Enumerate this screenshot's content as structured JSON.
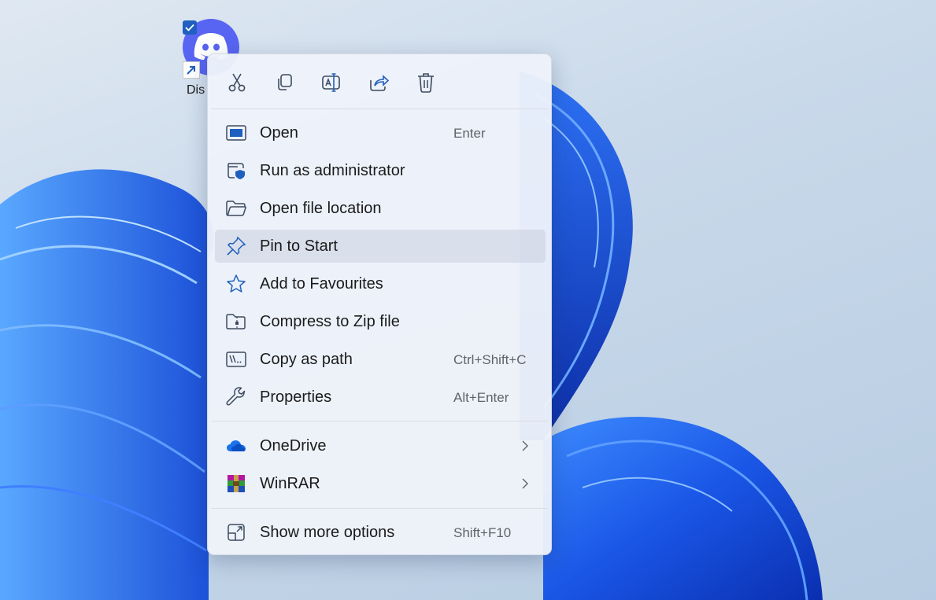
{
  "desktop": {
    "shortcut": {
      "label": "Dis",
      "icon": "discord-icon",
      "selected": true
    }
  },
  "context_menu": {
    "quick_actions": [
      {
        "name": "Cut",
        "icon": "scissors-icon"
      },
      {
        "name": "Copy",
        "icon": "copy-icon"
      },
      {
        "name": "Rename",
        "icon": "rename-icon"
      },
      {
        "name": "Share",
        "icon": "share-icon"
      },
      {
        "name": "Delete",
        "icon": "trash-icon"
      }
    ],
    "items": [
      {
        "label": "Open",
        "shortcut": "Enter",
        "icon": "open-window-icon"
      },
      {
        "label": "Run as administrator",
        "shortcut": "",
        "icon": "admin-shield-icon"
      },
      {
        "label": "Open file location",
        "shortcut": "",
        "icon": "folder-icon"
      },
      {
        "label": "Pin to Start",
        "shortcut": "",
        "icon": "pin-icon",
        "hovered": true
      },
      {
        "label": "Add to Favourites",
        "shortcut": "",
        "icon": "star-icon"
      },
      {
        "label": "Compress to Zip file",
        "shortcut": "",
        "icon": "zip-folder-icon"
      },
      {
        "label": "Copy as path",
        "shortcut": "Ctrl+Shift+C",
        "icon": "copy-path-icon"
      },
      {
        "label": "Properties",
        "shortcut": "Alt+Enter",
        "icon": "wrench-icon"
      }
    ],
    "submenus": [
      {
        "label": "OneDrive",
        "icon": "onedrive-cloud-icon"
      },
      {
        "label": "WinRAR",
        "icon": "winrar-icon"
      }
    ],
    "more": {
      "label": "Show more options",
      "shortcut": "Shift+F10",
      "icon": "show-more-icon"
    }
  },
  "colors": {
    "accent": "#1f5fbf",
    "discord": "#5865f2",
    "menu_background": "#eef2fa",
    "wallpaper_blue": "#1e5fe0"
  }
}
